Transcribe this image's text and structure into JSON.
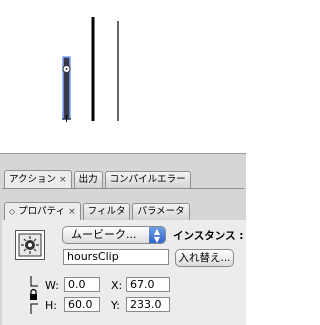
{
  "panel_tabs": [
    {
      "label": "アクション",
      "close": "×"
    },
    {
      "label": "出力"
    },
    {
      "label": "コンパイルエラー"
    }
  ],
  "property_tabs": [
    {
      "label": "プロパティ",
      "close": "×",
      "collapse": "◇"
    },
    {
      "label": "フィルタ"
    },
    {
      "label": "パラメータ"
    }
  ],
  "properties": {
    "symbol_type": "ムービーク...",
    "symbol_type_arrow": "▲▼",
    "instance_label": "インスタンス :",
    "instance_name": "hoursClip",
    "swap_button": "入れ替え...",
    "w_label": "W:",
    "w_value": "0.0",
    "h_label": "H:",
    "h_value": "60.0",
    "x_label": "X:",
    "x_value": "67.0",
    "y_label": "Y:",
    "y_value": "233.0",
    "icons": [
      "movieclip-icon",
      "constrain-lock-icon"
    ]
  },
  "colors": {
    "panel_bg": "#d6d6d6",
    "body_bg": "#ececec",
    "accent": "#2f64c8"
  }
}
